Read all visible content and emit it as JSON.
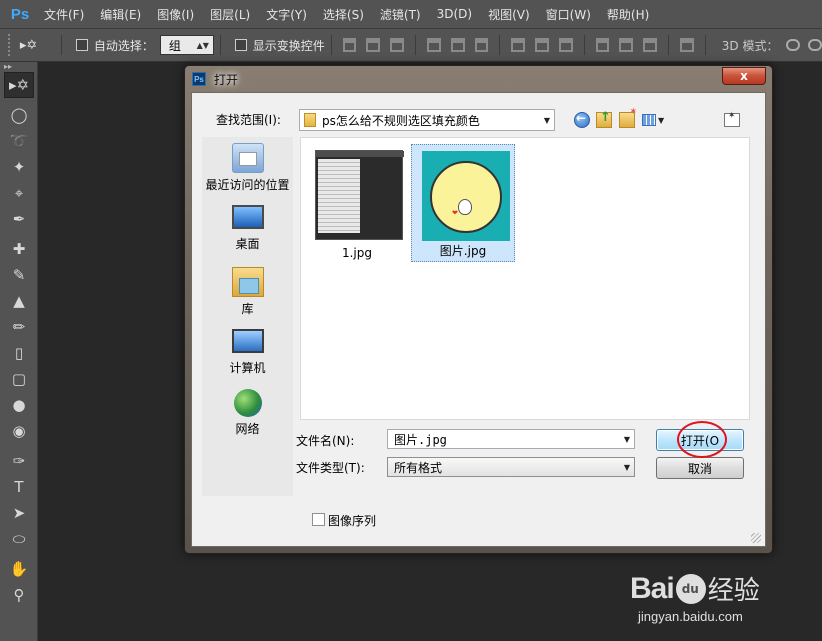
{
  "app": {
    "logo": "Ps",
    "menu": [
      "文件(F)",
      "编辑(E)",
      "图像(I)",
      "图层(L)",
      "文字(Y)",
      "选择(S)",
      "滤镜(T)",
      "3D(D)",
      "视图(V)",
      "窗口(W)",
      "帮助(H)"
    ]
  },
  "options_bar": {
    "tool_icon": "move-tool-icon",
    "auto_select_label": "自动选择：",
    "auto_select_checked": false,
    "group_value": "组",
    "show_transform_label": "显示变换控件",
    "show_transform_checked": false,
    "mode_3d_label": "3D 模式："
  },
  "tools": [
    "move-tool-icon",
    "marquee-tool-icon",
    "lasso-tool-icon",
    "magic-wand-icon",
    "crop-tool-icon",
    "eyedropper-icon",
    "healing-brush-icon",
    "brush-tool-icon",
    "clone-stamp-icon",
    "history-brush-icon",
    "eraser-icon",
    "gradient-icon",
    "blur-icon",
    "dodge-icon",
    "pen-tool-icon",
    "type-tool-icon",
    "path-select-icon",
    "shape-tool-icon",
    "hand-tool-icon",
    "zoom-tool-icon"
  ],
  "dialog": {
    "title": "打开",
    "close_label": "x",
    "look_in_label": "查找范围(I):",
    "look_in_value": "ps怎么给不规则选区填充颜色",
    "places": [
      {
        "label": "最近访问的位置",
        "icon": "recent-places-icon"
      },
      {
        "label": "桌面",
        "icon": "desktop-icon"
      },
      {
        "label": "库",
        "icon": "library-icon"
      },
      {
        "label": "计算机",
        "icon": "computer-icon"
      },
      {
        "label": "网络",
        "icon": "network-icon"
      }
    ],
    "files": [
      {
        "name": "1.jpg",
        "selected": false
      },
      {
        "name": "图片.jpg",
        "selected": true
      }
    ],
    "file_name_label": "文件名(N):",
    "file_name_value": "图片.jpg",
    "file_type_label": "文件类型(T):",
    "file_type_value": "所有格式",
    "open_button": "打开(O",
    "cancel_button": "取消",
    "image_sequence_label": "图像序列",
    "image_sequence_checked": false
  },
  "watermark": {
    "brand": "Bai",
    "paw_text": "du",
    "product": "经验",
    "url": "jingyan.baidu.com"
  },
  "colors": {
    "highlight_circle": "#e0141e",
    "app_background": "#282828",
    "panel": "#535353"
  }
}
